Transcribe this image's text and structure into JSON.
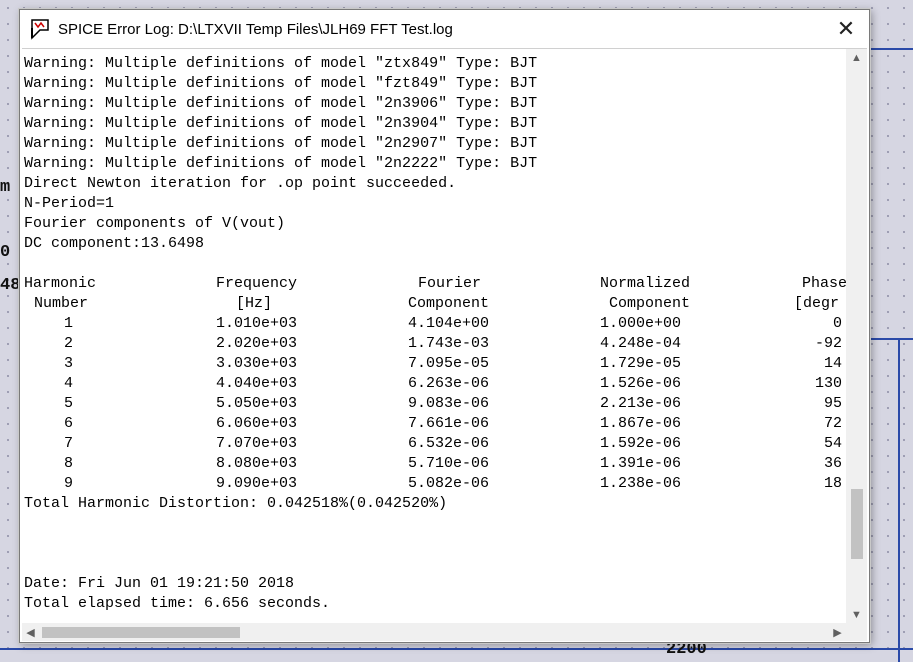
{
  "window": {
    "title": "SPICE Error Log: D:\\LTXVII Temp Files\\JLH69 FFT Test.log",
    "close_glyph": "✕"
  },
  "background": {
    "fragments": [
      "m",
      "0",
      "48",
      "2200"
    ]
  },
  "log_lines": [
    "Warning: Multiple definitions of model \"ztx849\" Type: BJT",
    "Warning: Multiple definitions of model \"fzt849\" Type: BJT",
    "Warning: Multiple definitions of model \"2n3906\" Type: BJT",
    "Warning: Multiple definitions of model \"2n3904\" Type: BJT",
    "Warning: Multiple definitions of model \"2n2907\" Type: BJT",
    "Warning: Multiple definitions of model \"2n2222\" Type: BJT",
    "Direct Newton iteration for .op point succeeded.",
    "N-Period=1",
    "Fourier components of V(vout)",
    "DC component:13.6498"
  ],
  "fourier_table": {
    "headers_line1": [
      "Harmonic",
      "Frequency",
      "Fourier",
      "Normalized",
      "Phase"
    ],
    "headers_line2": [
      "Number",
      "[Hz]",
      "Component",
      "Component",
      "[degr"
    ],
    "rows": [
      [
        "1",
        "1.010e+03",
        "4.104e+00",
        "1.000e+00",
        "0"
      ],
      [
        "2",
        "2.020e+03",
        "1.743e-03",
        "4.248e-04",
        "-92"
      ],
      [
        "3",
        "3.030e+03",
        "7.095e-05",
        "1.729e-05",
        "14"
      ],
      [
        "4",
        "4.040e+03",
        "6.263e-06",
        "1.526e-06",
        "130"
      ],
      [
        "5",
        "5.050e+03",
        "9.083e-06",
        "2.213e-06",
        "95"
      ],
      [
        "6",
        "6.060e+03",
        "7.661e-06",
        "1.867e-06",
        "72"
      ],
      [
        "7",
        "7.070e+03",
        "6.532e-06",
        "1.592e-06",
        "54"
      ],
      [
        "8",
        "8.080e+03",
        "5.710e-06",
        "1.391e-06",
        "36"
      ],
      [
        "9",
        "9.090e+03",
        "5.082e-06",
        "1.238e-06",
        "18"
      ]
    ],
    "thd_line": "Total Harmonic Distortion: 0.042518%(0.042520%)"
  },
  "footer_lines": [
    "Date: Fri Jun 01 19:21:50 2018",
    "Total elapsed time: 6.656 seconds."
  ],
  "icons": {
    "app": "spice-error-log-icon",
    "scroll_up": "▲",
    "scroll_down": "▼",
    "scroll_left": "◀",
    "scroll_right": "▶"
  },
  "colors": {
    "wire": "#2b4aa8",
    "scrollbar_track": "#f0f0f0",
    "scrollbar_thumb": "#c2c2c2"
  }
}
